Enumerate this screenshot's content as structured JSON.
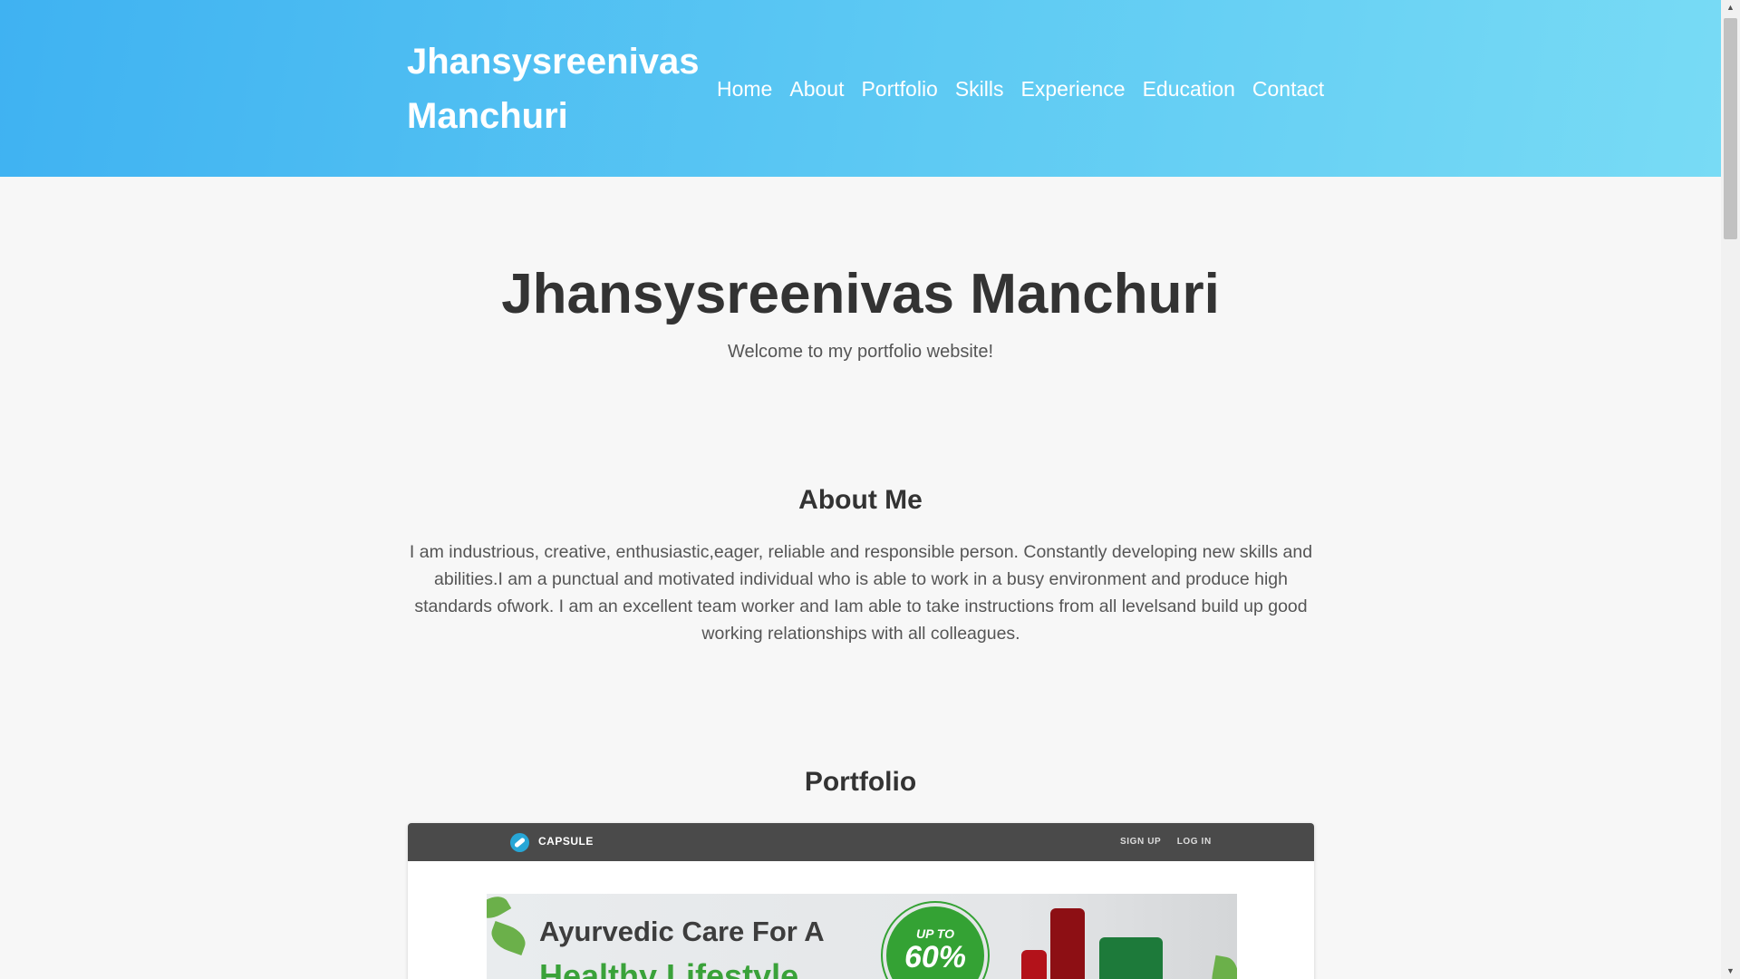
{
  "header": {
    "brand_line1": "Jhansysreenivas",
    "brand_line2": "Manchuri",
    "nav": [
      "Home",
      "About",
      "Portfolio",
      "Skills",
      "Experience",
      "Education",
      "Contact"
    ]
  },
  "hero": {
    "title": "Jhansysreenivas Manchuri",
    "subtitle": "Welcome to my portfolio website!"
  },
  "about": {
    "heading": "About Me",
    "text": "I am industrious, creative, enthusiastic,eager, reliable and responsible person. Constantly developing new skills and abilities.I am a punctual and motivated individual who is able to work in a busy environment and produce high standards ofwork. I am an excellent team worker and Iam able to take instructions from all levelsand build up good working relationships with all colleagues."
  },
  "portfolio": {
    "heading": "Portfolio",
    "preview": {
      "logo_icon": "pill-icon",
      "brand": "CAPSULE",
      "sign_up": "SIGN UP",
      "log_in": "LOG IN",
      "banner_line1": "Ayurvedic Care For A",
      "banner_line2": "Healthy Lifestyle",
      "badge_top": "UP TO",
      "badge_value": "60%"
    }
  },
  "colors": {
    "header_gradient_start": "#3fb2f2",
    "header_gradient_end": "#78dbf5",
    "page_background": "#f7f7f7",
    "text_dark": "#333333"
  }
}
